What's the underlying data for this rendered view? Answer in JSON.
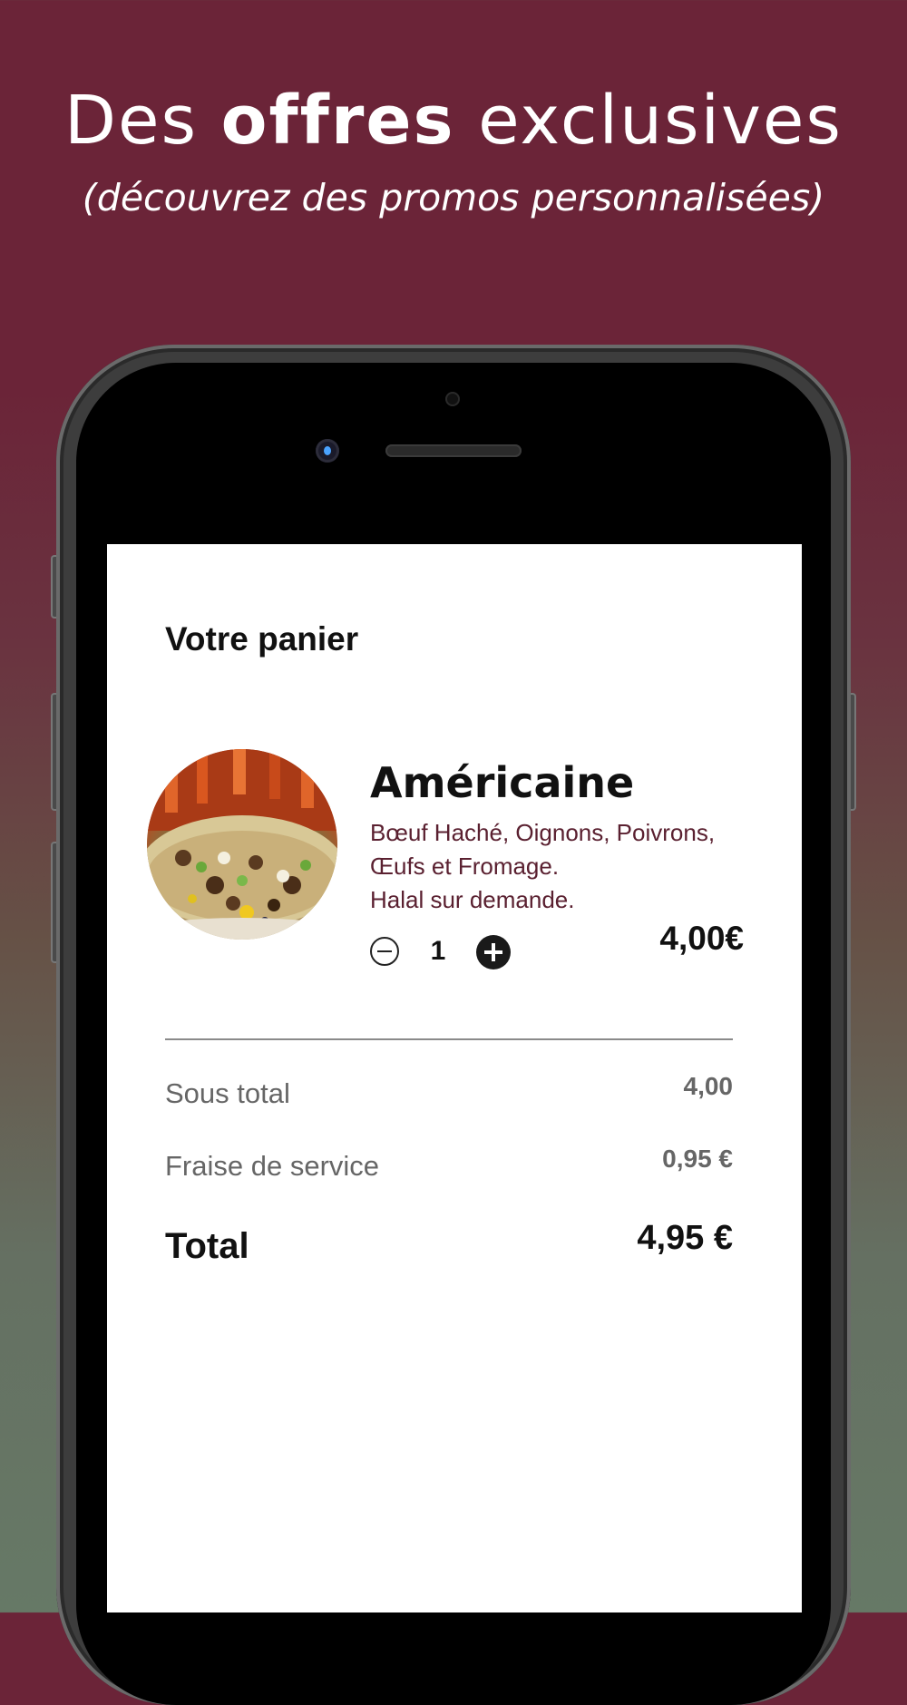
{
  "headline": {
    "prefix": "Des",
    "emphasis": "offres",
    "suffix": "exclusives",
    "subtitle": "(découvrez des promos personnalisées)"
  },
  "cart": {
    "title": "Votre panier",
    "item": {
      "name": "Américaine",
      "description_lines": [
        "Bœuf Haché, Oignons, Poivrons,",
        "Œufs et Fromage.",
        "Halal sur demande."
      ],
      "quantity": "1",
      "price": "4,00€"
    },
    "summary": {
      "subtotal_label": "Sous total",
      "subtotal_value": "4,00",
      "service_label": "Fraise de service",
      "service_value": "0,95 €",
      "total_label": "Total",
      "total_value": "4,95 €"
    }
  },
  "icons": {
    "minus": "minus-circle-icon",
    "plus": "plus-circle-icon"
  },
  "colors": {
    "background_top": "#6b2438",
    "background_bottom": "#667966",
    "description_text": "#5a2030"
  }
}
